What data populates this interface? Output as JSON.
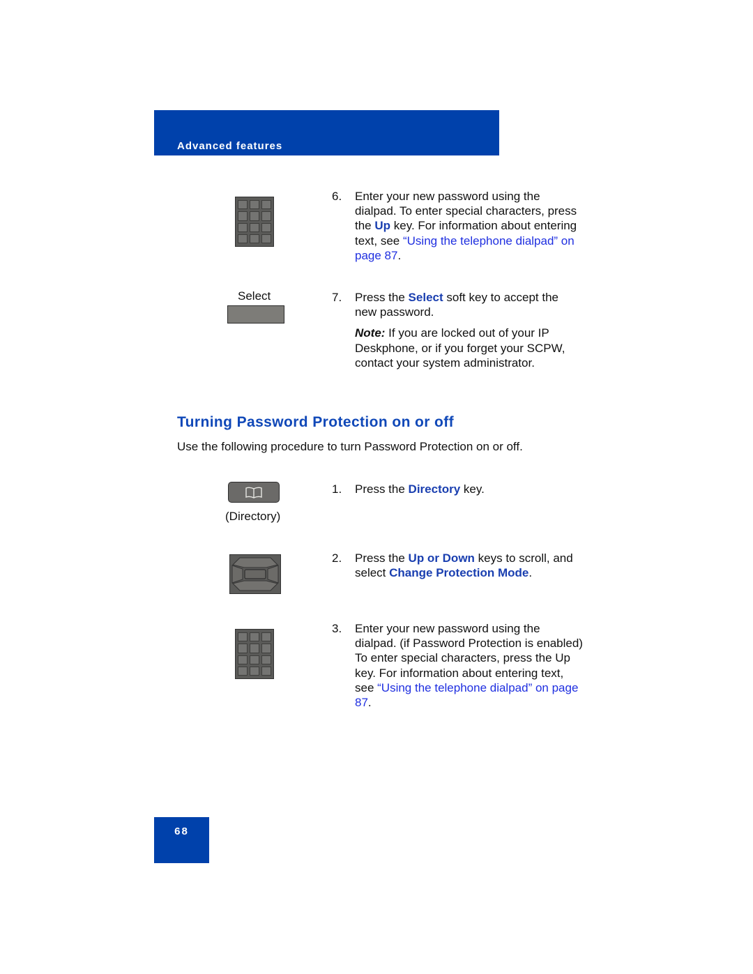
{
  "header": {
    "section_label": "Advanced features",
    "accent_color": "#0041ab"
  },
  "steps_top": [
    {
      "number": "6.",
      "text_1": "Enter your new password using the dialpad. To enter special characters, press the ",
      "key": "Up",
      "text_2": " key. For information about entering text, see ",
      "link": "“Using the telephone dialpad” on page 87",
      "text_3": ".",
      "icon": "dialpad-icon"
    },
    {
      "number": "7.",
      "text_1": "Press the ",
      "key": "Select",
      "text_2": " soft key to accept the new password.",
      "icon": "softkey-icon",
      "icon_label": "Select",
      "note_label": "Note:",
      "note_text": " If you are locked out of your IP Deskphone, or if you forget your SCPW, contact your system administrator."
    }
  ],
  "section": {
    "title": "Turning Password Protection on or off",
    "intro": "Use the following procedure to turn Password Protection on or off."
  },
  "steps_bottom": [
    {
      "number": "1.",
      "text_1": "Press the ",
      "key": "Directory",
      "text_2": " key.",
      "icon": "directory-key-icon",
      "icon_label": "(Directory)"
    },
    {
      "number": "2.",
      "text_1": "Press the ",
      "key": "Up or Down",
      "text_2": " keys to scroll, and select ",
      "key2": "Change Protection Mode",
      "text_3": ".",
      "icon": "navigation-cluster-icon"
    },
    {
      "number": "3.",
      "text_1": "Enter your new password using the dialpad. (if Password Protection is enabled)",
      "text_2": "To enter special characters, press the Up key. For information about entering text, see ",
      "link": "“Using the telephone dialpad” on page 87",
      "text_3": ".",
      "icon": "dialpad-icon"
    }
  ],
  "footer": {
    "page_number": "68"
  }
}
